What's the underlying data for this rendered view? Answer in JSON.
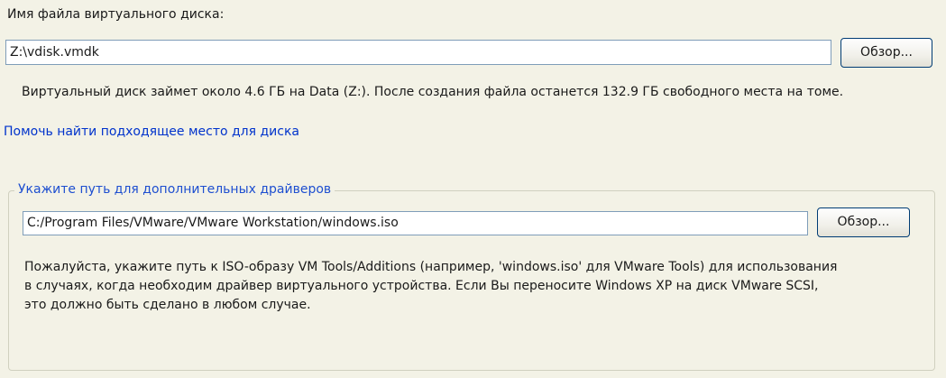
{
  "vdisk": {
    "label": "Имя файла виртуального диска:",
    "value": "Z:\\vdisk.vmdk",
    "browse_label": "Обзор..."
  },
  "info_text": "Виртуальный диск займет около 4.6 ГБ на Data (Z:). После создания файла останется 132.9 ГБ свободного места на томе.",
  "help_link": "Помочь найти подходящее место для диска",
  "drivers": {
    "group_title": "Укажите путь для дополнительных драйверов",
    "value": "C:/Program Files/VMware/VMware Workstation/windows.iso",
    "browse_label": "Обзор...",
    "description_lines": [
      "Пожалуйста, укажите путь к ISO-образу VM Tools/Additions (например, 'windows.iso' для VMware Tools) для использования",
      "в случаях, когда необходим драйвер виртуального устройства. Если Вы переносите Windows XP на диск VMware SCSI,",
      "это должно быть сделано в любом случае."
    ]
  },
  "colors": {
    "background": "#f3f2e6",
    "link": "#0033cc",
    "group_title": "#1e4fd0",
    "input_border": "#7f9db9",
    "button_border": "#003c74"
  }
}
